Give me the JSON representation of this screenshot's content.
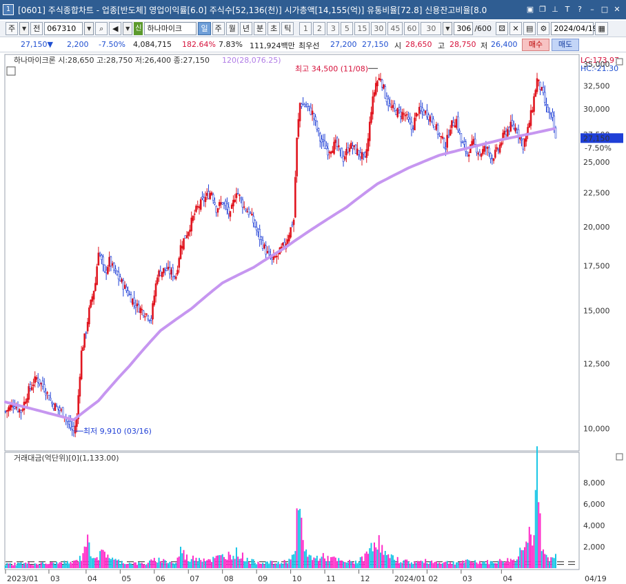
{
  "window": {
    "number": "1",
    "title": "[0601] 주식종합차트 - 업종[반도체] 영업이익률[6.0] 주식수[52,136(천)] 시가총액[14,155(억)] 유통비율[72.8] 신용잔고비율[8.0"
  },
  "toolbar": {
    "market": "주",
    "prev": "전",
    "code": "067310",
    "credit_tag": "신",
    "stock_name": "하나마이크",
    "periods": [
      "일",
      "주",
      "월",
      "년",
      "분",
      "초",
      "틱"
    ],
    "active_period": "일",
    "intervals": [
      "1",
      "2",
      "3",
      "5",
      "15",
      "30",
      "45",
      "60"
    ],
    "interval_sel": "30",
    "count": "306",
    "count_max": "/600",
    "date": "2024/04/19"
  },
  "quote": {
    "price": "27,150▼",
    "change": "2,200",
    "change_pct": "-7.50%",
    "volume": "4,084,715",
    "vol_ratio": "182.64%",
    "turnover": "7.83%",
    "amount": "111,924백만",
    "best_label": "최우선",
    "best_ask": "27,200",
    "best_bid": "27,150",
    "open_label": "시",
    "open": "28,650",
    "high_label": "고",
    "high": "28,750",
    "low_label": "저",
    "low": "26,400",
    "buy": "매수",
    "sell": "매도"
  },
  "chart_data": [
    {
      "type": "candlestick",
      "title": "하나마이크론 시:28,650 고:28,750 저:26,400 종:27,150",
      "ma_label": "120(28,076.25)",
      "lc_label": "LC:173.97",
      "hc_label": "HC:-21.30",
      "current_price": "27,150",
      "current_pct": "-7.50%",
      "annotation_high": "최고 34,500 (11/08)",
      "annotation_low": "최저 9,910 (03/16)",
      "y_ticks": [
        10000,
        12500,
        15000,
        17500,
        20000,
        22500,
        25000,
        27500,
        30000,
        32500,
        35000
      ],
      "y_tick_labels": [
        "10,000",
        "12,500",
        "15,000",
        "17,500",
        "20,000",
        "22,500",
        "25,000",
        "27,500",
        "30,000",
        "32,500",
        "35,000"
      ],
      "ylim": [
        9300,
        36200
      ],
      "close_path": [
        [
          0,
          10600
        ],
        [
          5,
          10900
        ],
        [
          10,
          10600
        ],
        [
          15,
          11400
        ],
        [
          20,
          11900
        ],
        [
          25,
          11500
        ],
        [
          30,
          10900
        ],
        [
          34,
          10700
        ],
        [
          38,
          10500
        ],
        [
          41,
          10100
        ],
        [
          44,
          9910
        ],
        [
          46,
          10300
        ],
        [
          49,
          13000
        ],
        [
          52,
          14000
        ],
        [
          54,
          15000
        ],
        [
          58,
          16500
        ],
        [
          60,
          18500
        ],
        [
          64,
          17000
        ],
        [
          67,
          17800
        ],
        [
          70,
          17200
        ],
        [
          75,
          16500
        ],
        [
          80,
          15800
        ],
        [
          85,
          15200
        ],
        [
          90,
          14900
        ],
        [
          94,
          14600
        ],
        [
          98,
          17000
        ],
        [
          103,
          17300
        ],
        [
          110,
          16900
        ],
        [
          113,
          18700
        ],
        [
          118,
          19800
        ],
        [
          123,
          21200
        ],
        [
          128,
          22000
        ],
        [
          133,
          22600
        ],
        [
          136,
          21300
        ],
        [
          140,
          21800
        ],
        [
          145,
          20800
        ],
        [
          149,
          22700
        ],
        [
          154,
          21400
        ],
        [
          158,
          20900
        ],
        [
          163,
          19500
        ],
        [
          168,
          18400
        ],
        [
          172,
          17800
        ],
        [
          176,
          18200
        ],
        [
          181,
          19000
        ],
        [
          186,
          20500
        ],
        [
          188,
          27000
        ],
        [
          190,
          30600
        ],
        [
          194,
          30300
        ],
        [
          198,
          29600
        ],
        [
          203,
          27000
        ],
        [
          208,
          26000
        ],
        [
          213,
          26600
        ],
        [
          218,
          25300
        ],
        [
          222,
          26500
        ],
        [
          228,
          25800
        ],
        [
          232,
          25200
        ],
        [
          234,
          27000
        ],
        [
          236,
          30000
        ],
        [
          239,
          32800
        ],
        [
          242,
          33500
        ],
        [
          245,
          31500
        ],
        [
          248,
          30200
        ],
        [
          252,
          29800
        ],
        [
          258,
          29400
        ],
        [
          262,
          28000
        ],
        [
          266,
          29800
        ],
        [
          272,
          29600
        ],
        [
          276,
          28700
        ],
        [
          280,
          27400
        ],
        [
          284,
          26400
        ],
        [
          287,
          28300
        ],
        [
          291,
          28900
        ],
        [
          294,
          26800
        ],
        [
          298,
          25800
        ],
        [
          302,
          26700
        ],
        [
          306,
          25700
        ],
        [
          310,
          26300
        ],
        [
          314,
          25400
        ],
        [
          318,
          26100
        ],
        [
          322,
          27600
        ],
        [
          326,
          28300
        ],
        [
          330,
          28000
        ],
        [
          334,
          26500
        ],
        [
          337,
          27900
        ],
        [
          340,
          30200
        ],
        [
          343,
          33200
        ],
        [
          346,
          31900
        ],
        [
          349,
          30100
        ],
        [
          353,
          28800
        ],
        [
          355,
          27150
        ]
      ],
      "ma120_path": [
        [
          0,
          10950
        ],
        [
          44,
          10300
        ],
        [
          60,
          11000
        ],
        [
          80,
          12400
        ],
        [
          100,
          14000
        ],
        [
          120,
          15100
        ],
        [
          140,
          16500
        ],
        [
          160,
          17400
        ],
        [
          180,
          18600
        ],
        [
          200,
          20000
        ],
        [
          220,
          21400
        ],
        [
          240,
          23200
        ],
        [
          260,
          24500
        ],
        [
          280,
          25600
        ],
        [
          300,
          26300
        ],
        [
          320,
          27000
        ],
        [
          340,
          27600
        ],
        [
          355,
          28076
        ]
      ],
      "x_tick_labels": [
        "2023/01",
        "03",
        "04",
        "05",
        "06",
        "07",
        "08",
        "09",
        "10",
        "11",
        "12",
        "2024/01",
        "02",
        "03",
        "04"
      ],
      "x_last_label": "04/19"
    },
    {
      "type": "bar",
      "title": "거래대금(억단위)[0](1,133.00)",
      "y_ticks": [
        2000,
        4000,
        6000,
        8000
      ],
      "y_tick_labels": [
        "2,000",
        "4,000",
        "6,000",
        "8,000"
      ],
      "ylim": [
        0,
        9800
      ],
      "volume_samples": [
        [
          0,
          400
        ],
        [
          10,
          500
        ],
        [
          20,
          450
        ],
        [
          30,
          500
        ],
        [
          44,
          600
        ],
        [
          49,
          1100
        ],
        [
          52,
          3000
        ],
        [
          56,
          1400
        ],
        [
          60,
          1200
        ],
        [
          64,
          1700
        ],
        [
          70,
          800
        ],
        [
          80,
          500
        ],
        [
          90,
          450
        ],
        [
          98,
          900
        ],
        [
          110,
          500
        ],
        [
          113,
          1900
        ],
        [
          118,
          900
        ],
        [
          123,
          1100
        ],
        [
          128,
          1000
        ],
        [
          133,
          900
        ],
        [
          149,
          1600
        ],
        [
          158,
          700
        ],
        [
          168,
          600
        ],
        [
          176,
          500
        ],
        [
          181,
          700
        ],
        [
          186,
          1200
        ],
        [
          188,
          4500
        ],
        [
          190,
          6000
        ],
        [
          192,
          2500
        ],
        [
          194,
          1800
        ],
        [
          198,
          900
        ],
        [
          203,
          1200
        ],
        [
          213,
          900
        ],
        [
          218,
          600
        ],
        [
          228,
          700
        ],
        [
          234,
          1500
        ],
        [
          236,
          2600
        ],
        [
          238,
          2800
        ],
        [
          240,
          3000
        ],
        [
          242,
          2200
        ],
        [
          246,
          1200
        ],
        [
          252,
          900
        ],
        [
          262,
          600
        ],
        [
          272,
          700
        ],
        [
          282,
          600
        ],
        [
          291,
          600
        ],
        [
          302,
          700
        ],
        [
          314,
          600
        ],
        [
          322,
          800
        ],
        [
          330,
          900
        ],
        [
          338,
          4300
        ],
        [
          340,
          2200
        ],
        [
          343,
          9300
        ],
        [
          346,
          1700
        ],
        [
          349,
          1200
        ],
        [
          353,
          900
        ],
        [
          355,
          1100
        ]
      ]
    }
  ],
  "colors": {
    "up": "#e0141e",
    "down": "#1f3fd6",
    "ma120": "#c696f0",
    "vol_up": "#ff2ac8",
    "vol_down": "#18c6e6",
    "title_bg": "#2f5d92"
  }
}
